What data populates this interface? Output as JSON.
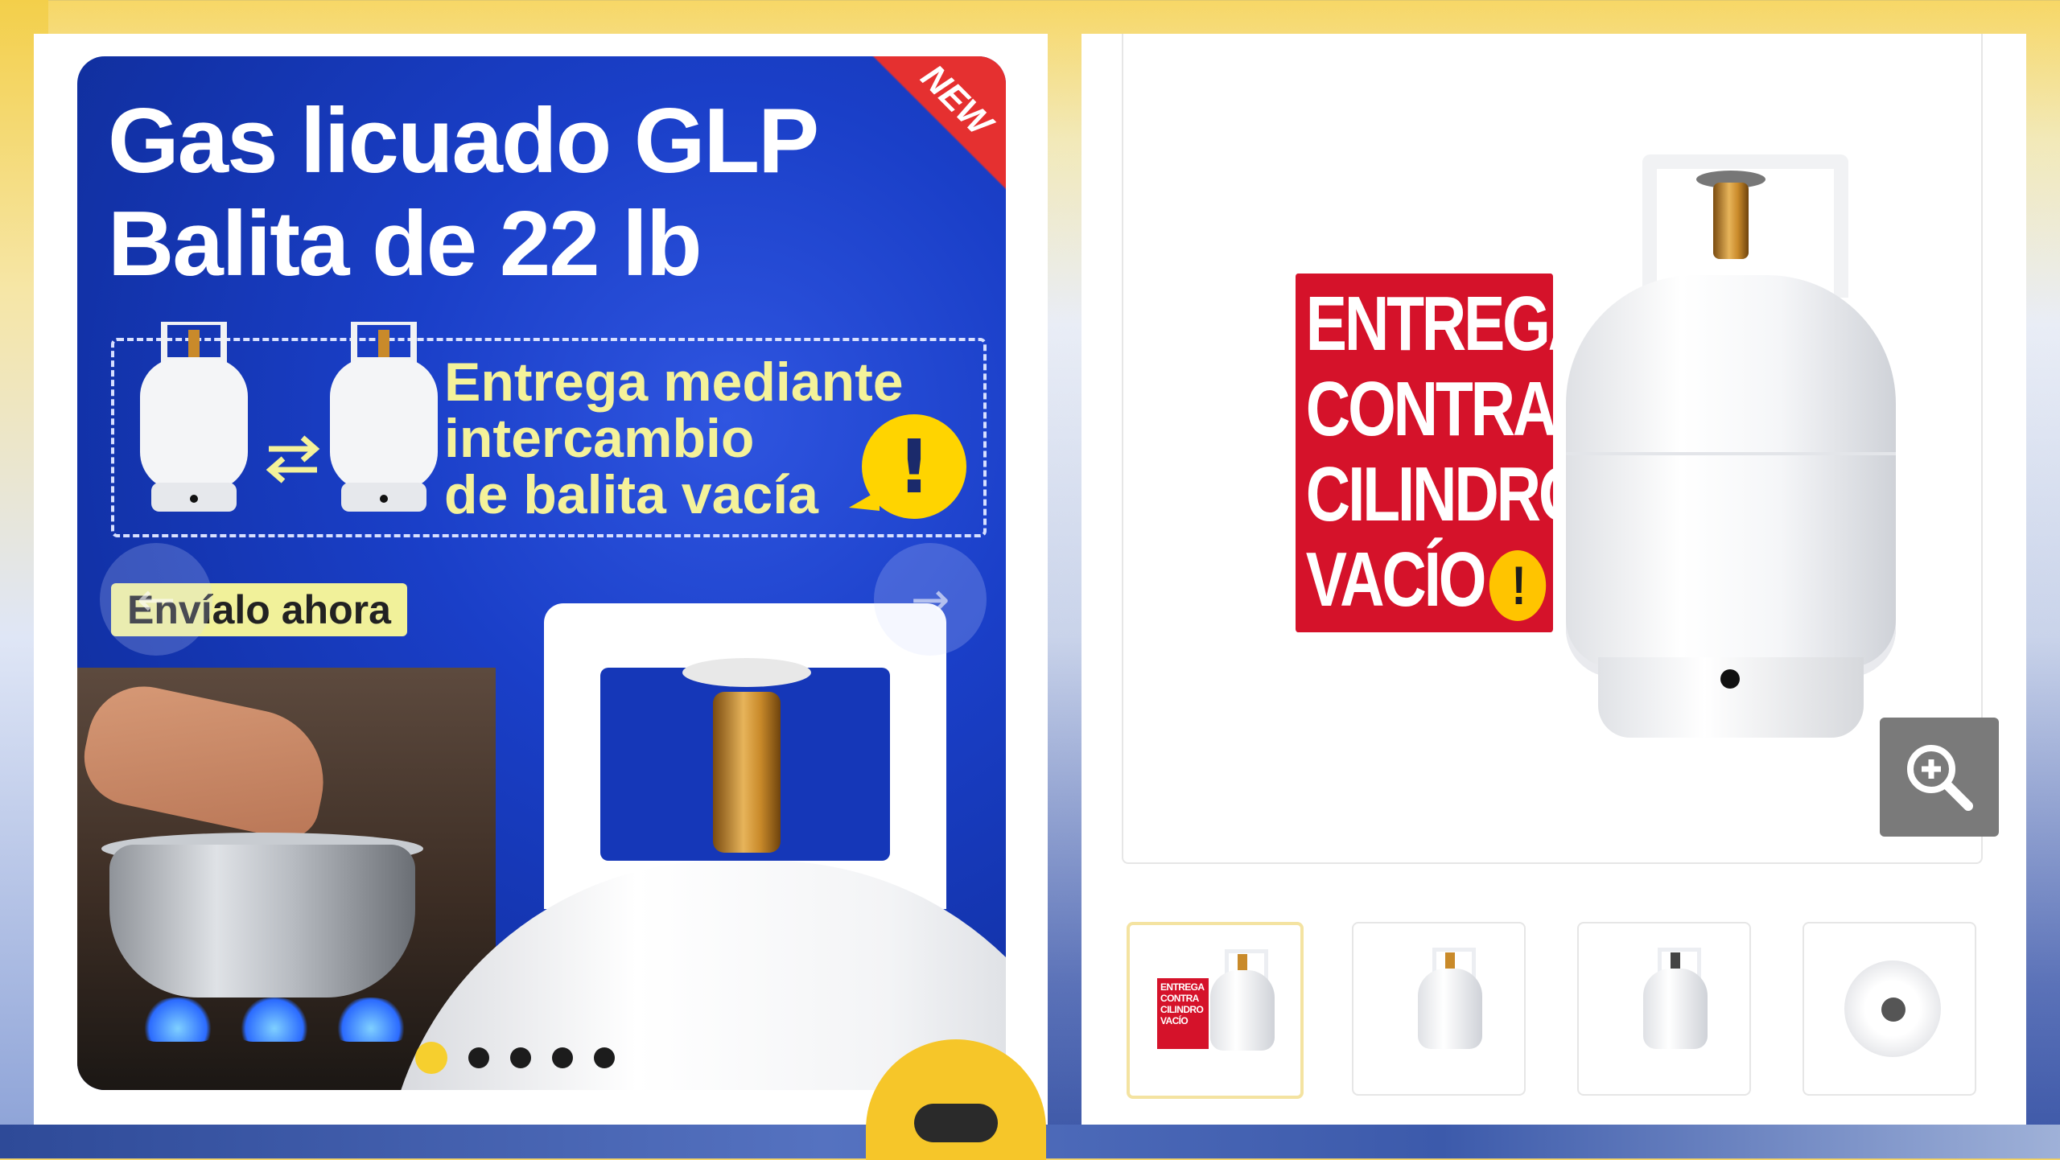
{
  "banner": {
    "title_line1": "Gas licuado  GLP",
    "title_line2": "Balita de 22 lb",
    "badge": "NEW",
    "exchange_lines": [
      "Entrega mediante",
      "intercambio",
      "de balita vacía"
    ],
    "warn_symbol": "!",
    "cta_label": "Envíalo ahora",
    "prev_arrow": "←",
    "next_arrow": "→",
    "dots_count": 5,
    "active_dot": 0
  },
  "product_label": {
    "lines": [
      "ENTREGA",
      "CONTRA",
      "CILINDRO",
      "VACÍO"
    ],
    "warn_symbol": "!"
  },
  "thumbnails": {
    "items": [
      {
        "name": "label-and-tank",
        "label_lines": [
          "ENTREGA",
          "CONTRA",
          "CILINDRO",
          "VACÍO"
        ]
      },
      {
        "name": "tank-front"
      },
      {
        "name": "tank-side"
      },
      {
        "name": "tank-top"
      }
    ],
    "active_index": 0
  },
  "icons": {
    "zoom": "zoom-in-icon",
    "chat": "chat-icon"
  },
  "colors": {
    "banner_blue": "#1a3fc8",
    "label_red": "#d5122a",
    "accent_yellow": "#f6cf2e",
    "exchange_text": "#f4f29a"
  }
}
